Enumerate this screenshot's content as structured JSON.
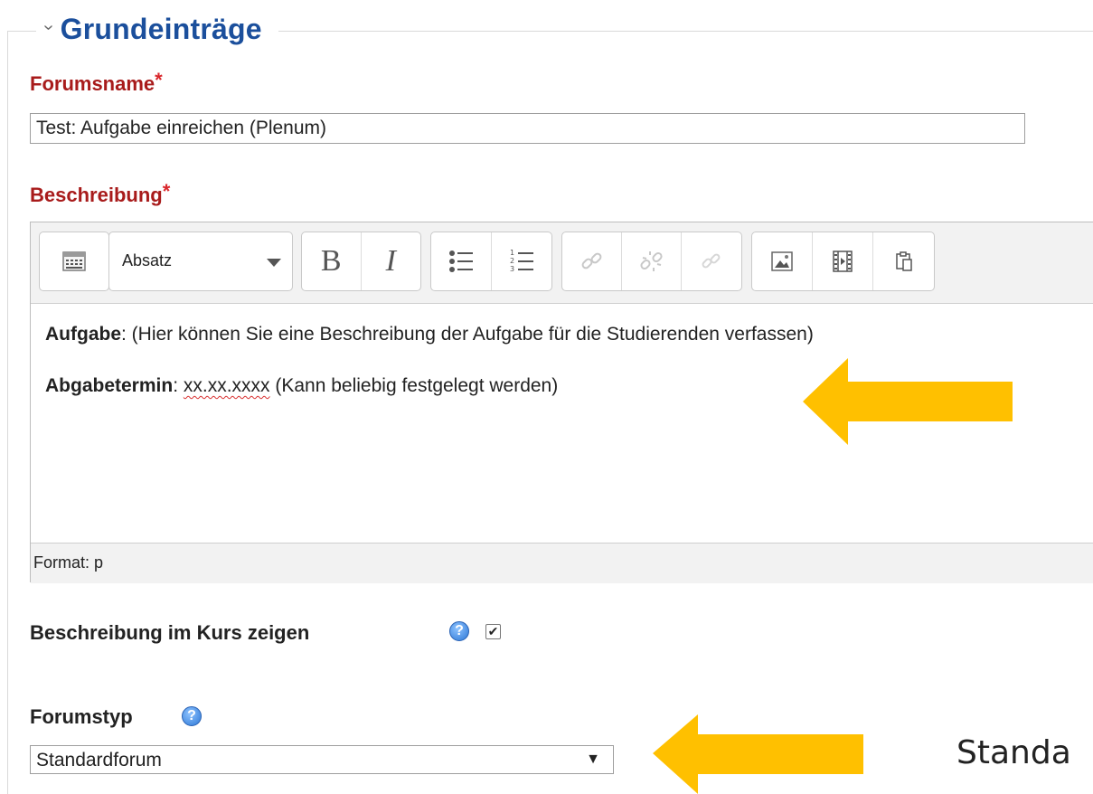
{
  "section": {
    "chevron": "›",
    "title": "Grundeinträge"
  },
  "forumsname": {
    "label": "Forumsname",
    "required_mark": "*",
    "value": "Test: Aufgabe einreichen (Plenum)"
  },
  "beschreibung": {
    "label": "Beschreibung",
    "required_mark": "*",
    "toolbar": {
      "paragraph_select": "Absatz",
      "bold": "B",
      "italic": "I"
    },
    "content": {
      "line1_bold": "Aufgabe",
      "line1_rest": ": (Hier können Sie eine Beschreibung der Aufgabe für die Studierenden verfassen)",
      "line2_bold": "Abgabetermin",
      "line2_sep": ": ",
      "line2_date": "xx.xx.xxxx",
      "line2_rest": " (Kann beliebig festgelegt werden)"
    },
    "statusbar": "Format: p"
  },
  "show_description": {
    "label": "Beschreibung im Kurs zeigen",
    "checked": true,
    "check_glyph": "✔",
    "help_glyph": "?"
  },
  "forumstyp": {
    "label": "Forumstyp",
    "help_glyph": "?",
    "selected": "Standardforum",
    "arrow_glyph": "▼"
  },
  "annotation": {
    "arrow_color": "#ffc000",
    "side_text": "Standa"
  },
  "colors": {
    "section_title": "#1b4f9c",
    "required_label": "#a81b1b",
    "required_star": "#d9262b"
  }
}
